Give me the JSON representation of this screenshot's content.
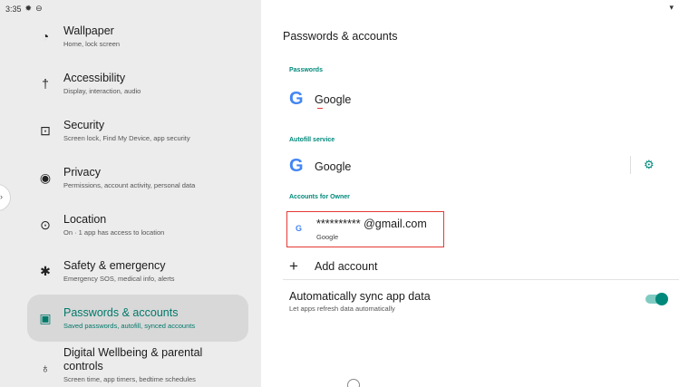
{
  "status_bar": {
    "time": "3:35",
    "icons": [
      "gear-icon",
      "vpn-icon"
    ],
    "right_icon": "wifi-icon"
  },
  "sidebar": {
    "items": [
      {
        "icon": "palette-icon",
        "glyph": "🎨",
        "title": "Wallpaper",
        "subtitle": "Home, lock screen"
      },
      {
        "icon": "accessibility-icon",
        "glyph": "♿",
        "title": "Accessibility",
        "subtitle": "Display, interaction, audio"
      },
      {
        "icon": "lock-icon",
        "glyph": "🔒",
        "title": "Security",
        "subtitle": "Screen lock, Find My Device, app security"
      },
      {
        "icon": "privacy-eye-icon",
        "glyph": "👁",
        "title": "Privacy",
        "subtitle": "Permissions, account activity, personal data"
      },
      {
        "icon": "location-pin-icon",
        "glyph": "📍",
        "title": "Location",
        "subtitle": "On · 1 app has access to location"
      },
      {
        "icon": "asterisk-icon",
        "glyph": "✱",
        "title": "Safety & emergency",
        "subtitle": "Emergency SOS, medical info, alerts"
      },
      {
        "icon": "key-icon",
        "glyph": "🔑",
        "title": "Passwords & accounts",
        "subtitle": "Saved passwords, autofill, synced accounts",
        "selected": true
      },
      {
        "icon": "wellbeing-icon",
        "glyph": "♾",
        "title": "Digital Wellbeing & parental controls",
        "subtitle": "Screen time, app timers, bedtime schedules"
      }
    ]
  },
  "main": {
    "title": "Passwords & accounts",
    "passwords_section": "Passwords",
    "passwords_provider": "Google",
    "autofill_section": "Autofill service",
    "autofill_provider": "Google",
    "accounts_section": "Accounts for Owner",
    "account_email": "********** @gmail.com",
    "account_provider": "Google",
    "add_account": "Add account",
    "sync_title": "Automatically sync app data",
    "sync_subtitle": "Let apps refresh data automatically",
    "sync_enabled": true
  },
  "colors": {
    "accent": "#00897b",
    "selection_bg": "#d8d8d8",
    "highlight_box": "#e53935",
    "google_blue": "#4285f4"
  }
}
